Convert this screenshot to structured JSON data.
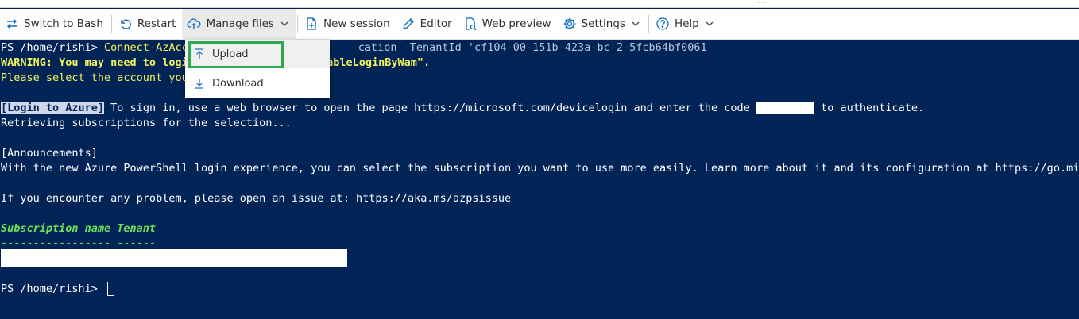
{
  "toolbar": {
    "items": [
      {
        "label": "Switch to Bash",
        "icon": "switch-arrows-icon"
      },
      {
        "label": "Restart",
        "icon": "restart-icon"
      },
      {
        "label": "Manage files",
        "icon": "cloud-upload-icon"
      },
      {
        "label": "New session",
        "icon": "new-session-icon"
      },
      {
        "label": "Editor",
        "icon": "pencil-icon"
      },
      {
        "label": "Web preview",
        "icon": "web-preview-icon"
      },
      {
        "label": "Settings",
        "icon": "gear-icon"
      },
      {
        "label": "Help",
        "icon": "help-icon"
      }
    ]
  },
  "menu": {
    "upload": "Upload",
    "download": "Download"
  },
  "terminal": {
    "line1_prompt": "PS /home/rishi> ",
    "line1_cmd_a": "Connect-AzAcc",
    "line1_cmd_b": "cation -TenantId ",
    "line1_tenant": "'cf104-00-151b-423a-bc-2-5fcb64bf0061",
    "line2_a": "WARNING: You may need to logi",
    "line2_b": "\"EnableLoginByWam\".",
    "line3": "Please select the account you",
    "line5_tag": "[Login to Azure]",
    "line5_text": " To sign in, use a web browser to open the page https://microsoft.com/devicelogin and enter the code ",
    "line5_after": " to authenticate.",
    "line6": "Retrieving subscriptions for the selection...",
    "line8": "[Announcements]",
    "line9": "With the new Azure PowerShell login experience, you can select the subscription you want to use more easily. Learn more about it and its configuration at https://go.microsoft.com",
    "line11": "If you encounter any problem, please open an issue at: https://aka.ms/azpsissue",
    "header": "Subscription name Tenant",
    "dashes": "----------------- ------",
    "prompt": "PS /home/rishi> "
  },
  "colors": {
    "terminal_bg": "#012456",
    "warning": "#f3f35a",
    "header_green": "#6de05a",
    "highlight_box": "#2ea84f",
    "icon_blue": "#0f6cbd"
  }
}
